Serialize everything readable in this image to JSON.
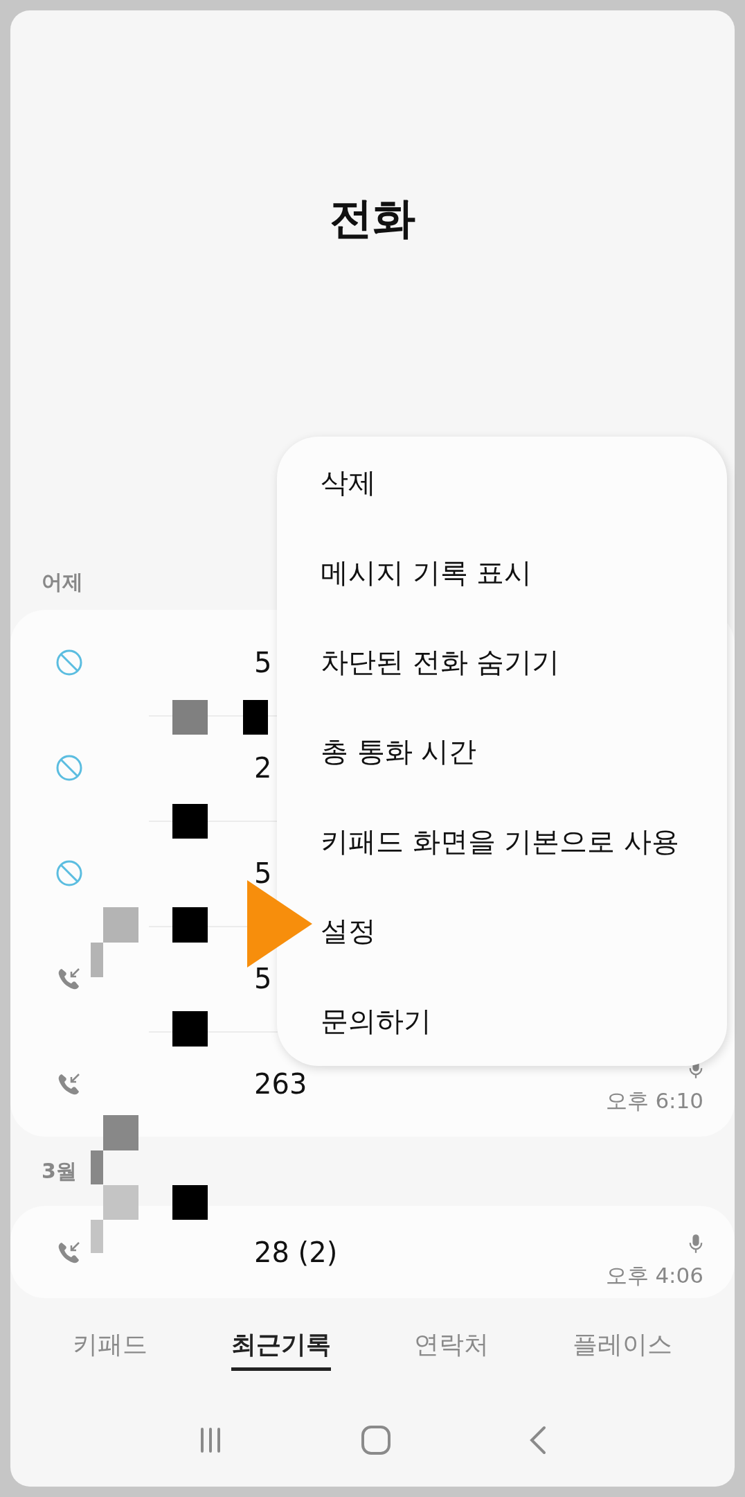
{
  "title": "전화",
  "sections": [
    {
      "header": "어제",
      "calls": [
        {
          "kind": "blocked",
          "number": "5"
        },
        {
          "kind": "blocked",
          "number": "2"
        },
        {
          "kind": "blocked",
          "number": "5"
        },
        {
          "kind": "incoming",
          "number": "5"
        },
        {
          "kind": "incoming",
          "number": "263",
          "recorded": true,
          "time": "오후 6:10"
        }
      ]
    },
    {
      "header": "3월",
      "calls": [
        {
          "kind": "incoming",
          "number": "28 (2)",
          "recorded": true,
          "time": "오후 4:06"
        }
      ]
    }
  ],
  "menu": {
    "items": [
      "삭제",
      "메시지 기록 표시",
      "차단된 전화 숨기기",
      "총 통화 시간",
      "키패드 화면을 기본으로 사용",
      "설정",
      "문의하기"
    ]
  },
  "tabs": [
    {
      "label": "키패드",
      "selected": false
    },
    {
      "label": "최근기록",
      "selected": true
    },
    {
      "label": "연락처",
      "selected": false
    },
    {
      "label": "플레이스",
      "selected": false
    }
  ]
}
